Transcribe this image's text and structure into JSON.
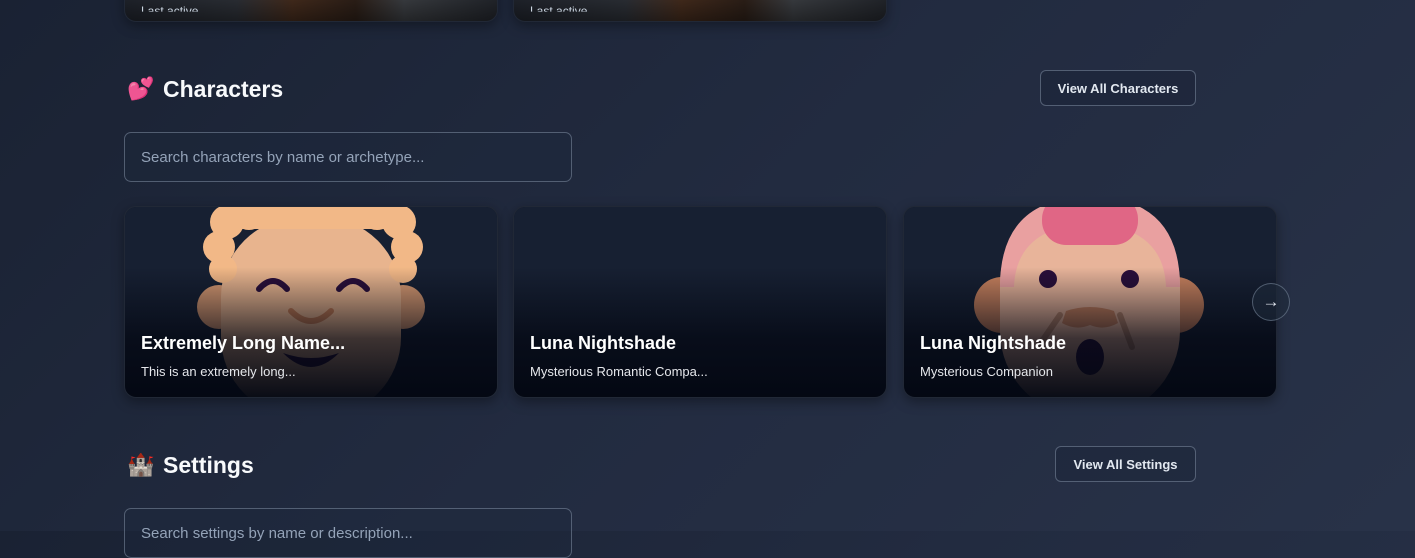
{
  "previous_section": {
    "cards": [
      {
        "subtitle": "Last active"
      },
      {
        "subtitle": "Last active"
      }
    ]
  },
  "characters": {
    "title": "Characters",
    "emoji": "💕",
    "view_all_label": "View All Characters",
    "search": {
      "placeholder": "Search characters by name or archetype...",
      "value": ""
    },
    "cards": [
      {
        "name": "Extremely Long Name...",
        "description": "This is an extremely long...",
        "avatar": "curly-hair-smiling-face"
      },
      {
        "name": "Luna Nightshade",
        "description": "Mysterious Romantic Compa...",
        "avatar": "none"
      },
      {
        "name": "Luna Nightshade",
        "description": "Mysterious Companion",
        "avatar": "bald-mustache-face"
      }
    ],
    "next_icon": "→"
  },
  "settings": {
    "title": "Settings",
    "emoji": "🏰",
    "view_all_label": "View All Settings",
    "search": {
      "placeholder": "Search settings by name or description...",
      "value": ""
    }
  },
  "colors": {
    "background": "#222b40",
    "card": "#111827",
    "border": "#94a3b8"
  }
}
